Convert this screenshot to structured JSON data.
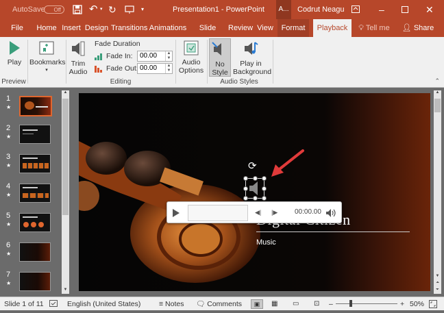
{
  "titlebar": {
    "autosave_label": "AutoSave",
    "autosave_state": "Off",
    "document_title": "Presentation1 - PowerPoint",
    "account_initial": "A...",
    "user_name": "Codrut Neagu"
  },
  "tabs": [
    {
      "label": "File"
    },
    {
      "label": "Home"
    },
    {
      "label": "Insert"
    },
    {
      "label": "Design"
    },
    {
      "label": "Transitions"
    },
    {
      "label": "Animations"
    },
    {
      "label": "Slide Show"
    },
    {
      "label": "Review"
    },
    {
      "label": "View"
    },
    {
      "label": "Format"
    },
    {
      "label": "Playback"
    }
  ],
  "tellme": "Tell me",
  "share": "Share",
  "ribbon": {
    "play_label": "Play",
    "preview_group": "Preview",
    "bookmarks_label": "Bookmarks",
    "trim_line1": "Trim",
    "trim_line2": "Audio",
    "fade_duration": "Fade Duration",
    "fade_in_label": "Fade In:",
    "fade_in_value": "00.00",
    "fade_out_label": "Fade Out:",
    "fade_out_value": "00.00",
    "editing_group": "Editing",
    "audio_options_line1": "Audio",
    "audio_options_line2": "Options",
    "no_style_line1": "No",
    "no_style_line2": "Style",
    "play_bg_line1": "Play in",
    "play_bg_line2": "Background",
    "audio_styles_group": "Audio Styles"
  },
  "thumbnails": [
    {
      "num": "1"
    },
    {
      "num": "2"
    },
    {
      "num": "3"
    },
    {
      "num": "4"
    },
    {
      "num": "5"
    },
    {
      "num": "6"
    },
    {
      "num": "7"
    }
  ],
  "slide": {
    "title": "Digital Citizen",
    "subtitle": "Music"
  },
  "player": {
    "time": "00:00.00"
  },
  "status": {
    "slide_counter": "Slide 1 of 11",
    "language": "English (United States)",
    "notes": "Notes",
    "comments": "Comments",
    "zoom": "50%"
  },
  "colors": {
    "brand": "#b7472a",
    "ribbon_bg": "#f0f0f0",
    "selection": "#e0662e",
    "arrow": "#e03a3a"
  }
}
